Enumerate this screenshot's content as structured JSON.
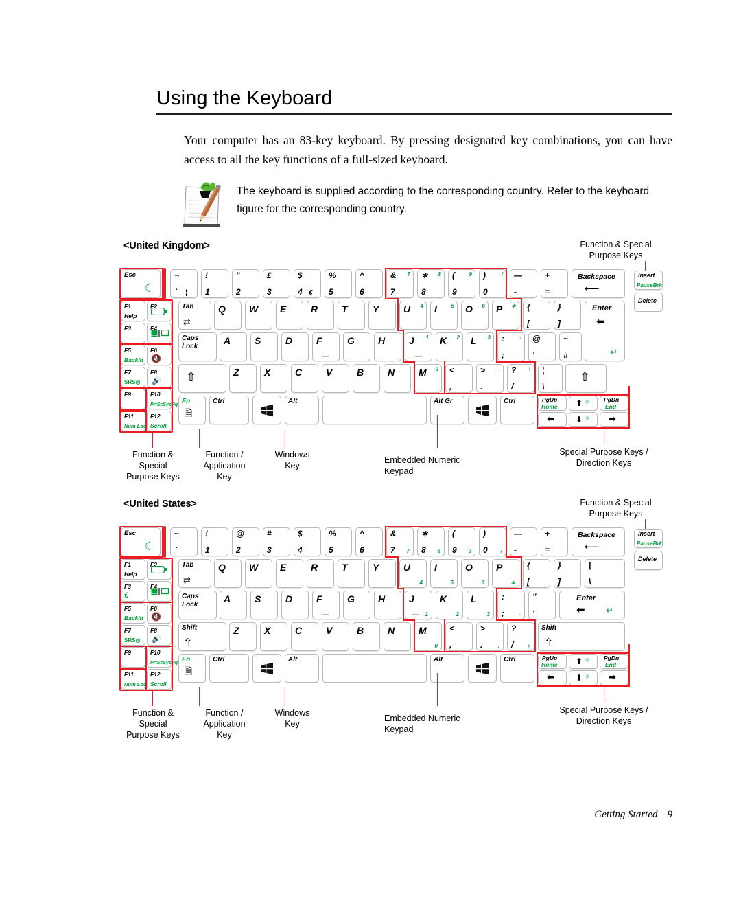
{
  "heading": {
    "title": "Using the Keyboard"
  },
  "intro": {
    "paragraph": "Your computer has an 83-key keyboard. By pressing designated key combinations, you can have access to all the key functions of a full-sized keyboard."
  },
  "note": {
    "icon": "note-pen-icon",
    "text": "The keyboard is supplied according to the corresponding country. Refer to the keyboard figure for the corresponding country."
  },
  "colors": {
    "highlight_red": "#ed1c24",
    "legend_green": "#00a03c",
    "key_border": "#b9b9bd",
    "rule": "#231f20"
  },
  "sections": [
    {
      "title": "<United Kingdom>",
      "callouts": {
        "top_right": "Function & Special\nPurpose Keys",
        "bottom": [
          "Function &\nSpecial\nPurpose Keys",
          "Function /\nApplication\nKey",
          "Windows\nKey",
          "Embedded Numeric\nKeypad",
          "Special Purpose Keys /\nDirection Keys"
        ]
      },
      "keys": {
        "fn_column": [
          {
            "top": "F1",
            "bottom": "Help"
          },
          {
            "top": "F2",
            "bottom": "battery-icon"
          },
          {
            "top": "F3",
            "bottom": ""
          },
          {
            "top": "F4",
            "bottom": "display-switch-icon"
          },
          {
            "top": "F5",
            "bottom": "Backlit"
          },
          {
            "top": "F6",
            "bottom": "mute-icon"
          },
          {
            "top": "F7",
            "bottom": "SRS"
          },
          {
            "top": "F8",
            "bottom": "volume-icon"
          },
          {
            "top": "F9",
            "bottom": ""
          },
          {
            "top": "F10",
            "bottom": "PrtScSysRq"
          },
          {
            "top": "F11",
            "bottom": "Num Lock"
          },
          {
            "top": "F12",
            "bottom": "Scroll"
          }
        ],
        "escape": "Esc",
        "number_row": [
          {
            "up": "¬",
            "down": "`",
            "down2": "¦"
          },
          {
            "up": "!",
            "down": "1"
          },
          {
            "up": "\"",
            "down": "2"
          },
          {
            "up": "£",
            "down": "3"
          },
          {
            "up": "$",
            "down": "4",
            "down2": "€"
          },
          {
            "up": "%",
            "down": "5"
          },
          {
            "up": "^",
            "down": "6"
          },
          {
            "up": "&",
            "down": "7",
            "keypad": "7"
          },
          {
            "up": "∗",
            "down": "8",
            "keypad": "8"
          },
          {
            "up": "(",
            "down": "9",
            "keypad": "9"
          },
          {
            "up": ")",
            "down": "0",
            "keypad": "/"
          },
          {
            "up": "—",
            "down": "-"
          },
          {
            "up": "+",
            "down": "="
          },
          {
            "label": "Backspace"
          }
        ],
        "row_q": [
          "Tab",
          "Q",
          "W",
          "E",
          "R",
          "T",
          "Y",
          "U",
          "I",
          "O",
          "P"
        ],
        "row_q_keypad": {
          "U": "4",
          "I": "5",
          "O": "6",
          "P": "∗"
        },
        "row_q_tail": [
          {
            "up": "{",
            "down": "["
          },
          {
            "up": "}",
            "down": "]"
          },
          {
            "label": "Enter"
          }
        ],
        "row_a": [
          "Caps\nLock",
          "A",
          "S",
          "D",
          "F",
          "G",
          "H",
          "J",
          "K",
          "L"
        ],
        "row_a_keypad": {
          "J": "1",
          "K": "2",
          "L": "3"
        },
        "row_a_tail": [
          {
            "up": ":",
            "down": ";",
            "keypad": "-"
          },
          {
            "up": "@",
            "down": "'"
          },
          {
            "up": "~",
            "down": "#",
            "keypad": "enter-icon"
          }
        ],
        "row_z": [
          "shift-icon",
          "Z",
          "X",
          "C",
          "V",
          "B",
          "N",
          "M"
        ],
        "row_z_keypad": {
          "M": "0"
        },
        "row_z_tail": [
          {
            "up": "<",
            "down": ","
          },
          {
            "up": ">",
            "down": ".",
            "keypad": "."
          },
          {
            "up": "?",
            "down": "/",
            "keypad": "+"
          },
          {
            "up": "¦",
            "down": "\\"
          },
          {
            "label": "shift-icon"
          }
        ],
        "bottom_row": [
          "Fn",
          "Ctrl",
          "windows-icon",
          "Alt",
          "space",
          "Alt Gr",
          "windows-icon",
          "Ctrl"
        ],
        "nav_block": [
          {
            "top": "Insert",
            "bottom": "PauseBrk"
          },
          {
            "top": "Delete",
            "bottom": ""
          }
        ],
        "arrows": [
          {
            "top": "PgUp",
            "bottom": "Home"
          },
          {
            "glyph": "arrow-up-icon",
            "fn": "brightness-up-icon"
          },
          {
            "top": "PgDn",
            "bottom": "End"
          },
          {
            "glyph": "arrow-left-icon"
          },
          {
            "glyph": "arrow-down-icon",
            "fn": "brightness-down-icon"
          },
          {
            "glyph": "arrow-right-icon"
          }
        ]
      }
    },
    {
      "title": "<United States>",
      "callouts": {
        "top_right": "Function & Special\nPurpose Keys",
        "bottom": [
          "Function &\nSpecial\nPurpose Keys",
          "Function /\nApplication\nKey",
          "Windows\nKey",
          "Embedded Numeric\nKeypad",
          "Special Purpose Keys /\nDirection Keys"
        ]
      },
      "keys": {
        "fn_column": [
          {
            "top": "F1",
            "bottom": "Help"
          },
          {
            "top": "F2",
            "bottom": "battery-icon"
          },
          {
            "top": "F3",
            "bottom": "€"
          },
          {
            "top": "F4",
            "bottom": "display-switch-icon"
          },
          {
            "top": "F5",
            "bottom": "Backlit"
          },
          {
            "top": "F6",
            "bottom": "mute-icon"
          },
          {
            "top": "F7",
            "bottom": "SRS"
          },
          {
            "top": "F8",
            "bottom": "volume-icon"
          },
          {
            "top": "F9",
            "bottom": ""
          },
          {
            "top": "F10",
            "bottom": "PrtScSysRq"
          },
          {
            "top": "F11",
            "bottom": "Num Lock"
          },
          {
            "top": "F12",
            "bottom": "Scroll"
          }
        ],
        "escape": "Esc",
        "number_row": [
          {
            "up": "~",
            "down": "`"
          },
          {
            "up": "!",
            "down": "1"
          },
          {
            "up": "@",
            "down": "2"
          },
          {
            "up": "#",
            "down": "3"
          },
          {
            "up": "$",
            "down": "4"
          },
          {
            "up": "%",
            "down": "5"
          },
          {
            "up": "^",
            "down": "6"
          },
          {
            "up": "&",
            "down": "7",
            "keypad": "7"
          },
          {
            "up": "∗",
            "down": "8",
            "keypad": "8"
          },
          {
            "up": "(",
            "down": "9",
            "keypad": "9"
          },
          {
            "up": ")",
            "down": "0",
            "keypad": "/"
          },
          {
            "up": "—",
            "down": "-"
          },
          {
            "up": "+",
            "down": "="
          },
          {
            "label": "Backspace"
          }
        ],
        "row_q": [
          "Tab",
          "Q",
          "W",
          "E",
          "R",
          "T",
          "Y",
          "U",
          "I",
          "O",
          "P"
        ],
        "row_q_keypad": {
          "U": "4",
          "I": "5",
          "O": "6",
          "P": "∗"
        },
        "row_q_tail": [
          {
            "up": "{",
            "down": "["
          },
          {
            "up": "}",
            "down": "]"
          },
          {
            "up": "|",
            "down": "\\"
          }
        ],
        "row_a": [
          "Caps\nLock",
          "A",
          "S",
          "D",
          "F",
          "G",
          "H",
          "J",
          "K",
          "L"
        ],
        "row_a_keypad": {
          "J": "1",
          "K": "2",
          "L": "3"
        },
        "row_a_tail": [
          {
            "up": ":",
            "down": ";",
            "keypad": "-"
          },
          {
            "up": "\"",
            "down": "'"
          },
          {
            "label": "Enter"
          }
        ],
        "row_z": [
          "Shift",
          "Z",
          "X",
          "C",
          "V",
          "B",
          "N",
          "M"
        ],
        "row_z_keypad": {
          "M": "0"
        },
        "row_z_tail": [
          {
            "up": "<",
            "down": ","
          },
          {
            "up": ">",
            "down": ".",
            "keypad": "."
          },
          {
            "up": "?",
            "down": "/",
            "keypad": "+"
          },
          {
            "label": "Shift"
          }
        ],
        "bottom_row": [
          "Fn",
          "Ctrl",
          "windows-icon",
          "Alt",
          "space",
          "Alt",
          "windows-icon",
          "Ctrl"
        ],
        "nav_block": [
          {
            "top": "Insert",
            "bottom": "PauseBrk"
          },
          {
            "top": "Delete",
            "bottom": ""
          }
        ],
        "arrows": [
          {
            "top": "PgUp",
            "bottom": "Home"
          },
          {
            "glyph": "arrow-up-icon",
            "fn": "brightness-up-icon"
          },
          {
            "top": "PgDn",
            "bottom": "End"
          },
          {
            "glyph": "arrow-left-icon"
          },
          {
            "glyph": "arrow-down-icon",
            "fn": "brightness-down-icon"
          },
          {
            "glyph": "arrow-right-icon"
          }
        ]
      }
    }
  ],
  "footer": {
    "text": "Getting Started",
    "page": "9"
  }
}
